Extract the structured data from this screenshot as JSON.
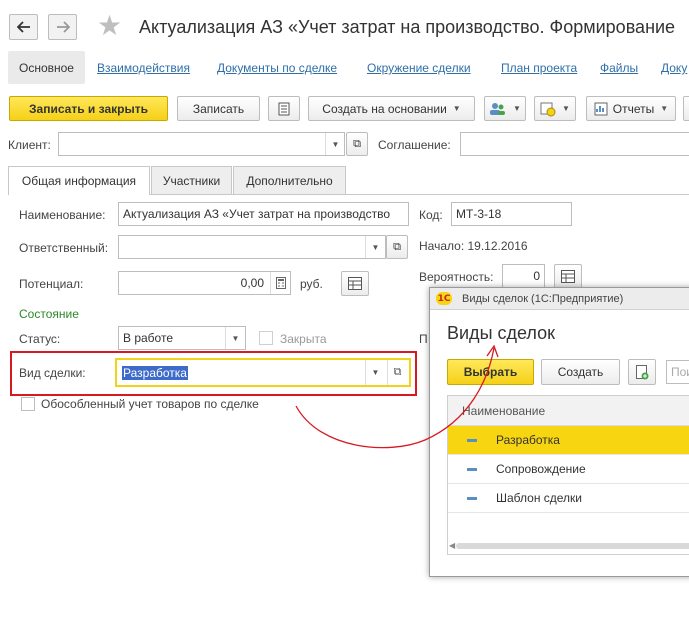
{
  "window": {
    "title": "Актуализация АЗ «Учет затрат на производство. Формирование"
  },
  "tabs": [
    {
      "label": "Основное"
    },
    {
      "label": "Взаимодействия"
    },
    {
      "label": "Документы по сделке"
    },
    {
      "label": "Окружение сделки"
    },
    {
      "label": "План проекта"
    },
    {
      "label": "Файлы"
    },
    {
      "label": "Доку"
    }
  ],
  "toolbar": {
    "save_close_label": "Записать и закрыть",
    "save_label": "Записать",
    "create_based_label": "Создать на основании",
    "reports_label": "Отчеты"
  },
  "client": {
    "label": "Клиент:",
    "value": ""
  },
  "agreement": {
    "label": "Соглашение:",
    "value": ""
  },
  "form_tabs": [
    {
      "label": "Общая информация"
    },
    {
      "label": "Участники"
    },
    {
      "label": "Дополнительно"
    }
  ],
  "form": {
    "name_label": "Наименование:",
    "name_value": "Актуализация АЗ «Учет затрат на производство",
    "code_label": "Код:",
    "code_value": "МТ-3-18",
    "responsible_label": "Ответственный:",
    "responsible_value": "",
    "start_label": "Начало: 19.12.2016",
    "potential_label": "Потенциал:",
    "potential_value": "0,00",
    "currency": "руб.",
    "probability_label": "Вероятность:",
    "probability_value": "0",
    "state_section": "Состояние",
    "status_label": "Статус:",
    "status_value": "В работе",
    "closed_label": "Закрыта",
    "p_label": "П",
    "deal_type_label": "Вид сделки:",
    "deal_type_value": "Разработка",
    "separate_accounting_label": "Обособленный учет товаров по сделке"
  },
  "popup": {
    "window_title": "Виды сделок  (1С:Предприятие)",
    "heading": "Виды сделок",
    "select_label": "Выбрать",
    "create_label": "Создать",
    "search_placeholder": "Пои",
    "column_header": "Наименование",
    "rows": [
      {
        "label": "Разработка",
        "selected": true
      },
      {
        "label": "Сопровождение",
        "selected": false
      },
      {
        "label": "Шаблон сделки",
        "selected": false
      }
    ]
  },
  "colors": {
    "accent_yellow": "#f7d511",
    "link_blue": "#2f6fa7",
    "highlight_red": "#d71920",
    "section_green": "#2a8a2a",
    "selection_blue": "#3d6bc9"
  }
}
